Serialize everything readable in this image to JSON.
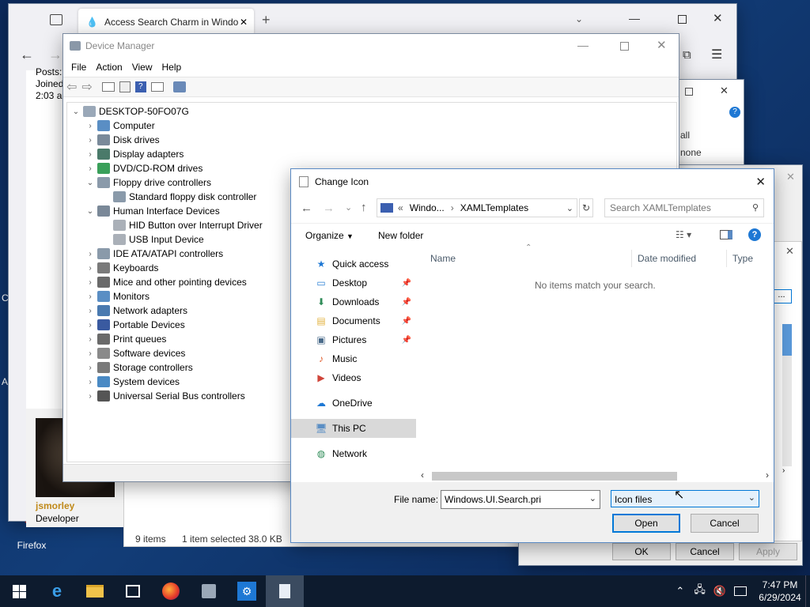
{
  "browser": {
    "tab_title": "Access Search Charm in Windo",
    "forum": {
      "posts_label": "Posts:",
      "joined_label": "Joined:",
      "time_text": "2:03 a",
      "username": "jsmorley",
      "role": "Developer"
    }
  },
  "desktop": {
    "firefox_label": "Firefox"
  },
  "device_manager": {
    "title": "Device Manager",
    "menu": [
      "File",
      "Action",
      "View",
      "Help"
    ],
    "root": "DESKTOP-50FO07G",
    "nodes": [
      {
        "label": "Computer",
        "expanded": false
      },
      {
        "label": "Disk drives",
        "expanded": false
      },
      {
        "label": "Display adapters",
        "expanded": false
      },
      {
        "label": "DVD/CD-ROM drives",
        "expanded": false
      },
      {
        "label": "Floppy drive controllers",
        "expanded": true
      },
      {
        "label": "Standard floppy disk controller",
        "child": true
      },
      {
        "label": "Human Interface Devices",
        "expanded": true
      },
      {
        "label": "HID Button over Interrupt Driver",
        "child": true
      },
      {
        "label": "USB Input Device",
        "child": true
      },
      {
        "label": "IDE ATA/ATAPI controllers",
        "expanded": false
      },
      {
        "label": "Keyboards",
        "expanded": false
      },
      {
        "label": "Mice and other pointing devices",
        "expanded": false
      },
      {
        "label": "Monitors",
        "expanded": false
      },
      {
        "label": "Network adapters",
        "expanded": false
      },
      {
        "label": "Portable Devices",
        "expanded": false
      },
      {
        "label": "Print queues",
        "expanded": false
      },
      {
        "label": "Software devices",
        "expanded": false
      },
      {
        "label": "Storage controllers",
        "expanded": false
      },
      {
        "label": "System devices",
        "expanded": false
      },
      {
        "label": "Universal Serial Bus controllers",
        "expanded": false
      }
    ]
  },
  "explorer_status": {
    "items": "9 items",
    "selected": "1 item selected  38.0 KB"
  },
  "behind_dialog": {
    "opt1": "all",
    "opt2": "none",
    "ok": "OK",
    "cancel": "Cancel",
    "apply": "Apply",
    "browse": "..."
  },
  "change_icon": {
    "title": "Change Icon",
    "path": [
      "Windo...",
      "XAMLTemplates"
    ],
    "search_placeholder": "Search XAMLTemplates",
    "organize": "Organize",
    "new_folder": "New folder",
    "nav": [
      {
        "label": "Quick access",
        "icon": "star-icon",
        "color": "#1e78d4"
      },
      {
        "label": "Desktop",
        "icon": "desktop-icon",
        "color": "#2a7fd4",
        "pinned": true
      },
      {
        "label": "Downloads",
        "icon": "download-icon",
        "color": "#2e8b57",
        "pinned": true
      },
      {
        "label": "Documents",
        "icon": "documents-icon",
        "color": "#e3b341",
        "pinned": true
      },
      {
        "label": "Pictures",
        "icon": "pictures-icon",
        "color": "#4a6b8a",
        "pinned": true
      },
      {
        "label": "Music",
        "icon": "music-icon",
        "color": "#e05a2a"
      },
      {
        "label": "Videos",
        "icon": "videos-icon",
        "color": "#d0453a"
      },
      {
        "label": "OneDrive",
        "icon": "cloud-icon",
        "color": "#1e78d4"
      },
      {
        "label": "This PC",
        "icon": "computer-icon",
        "color": "#5a8ec4"
      },
      {
        "label": "Network",
        "icon": "network-icon",
        "color": "#2e8b57"
      }
    ],
    "columns": [
      "Name",
      "Date modified",
      "Type"
    ],
    "empty_text": "No items match your search.",
    "filename_label": "File name:",
    "filename_value": "Windows.UI.Search.pri",
    "filetype_value": "Icon files",
    "open": "Open",
    "cancel": "Cancel"
  },
  "taskbar": {
    "time": "7:47 PM",
    "date": "6/29/2024"
  }
}
